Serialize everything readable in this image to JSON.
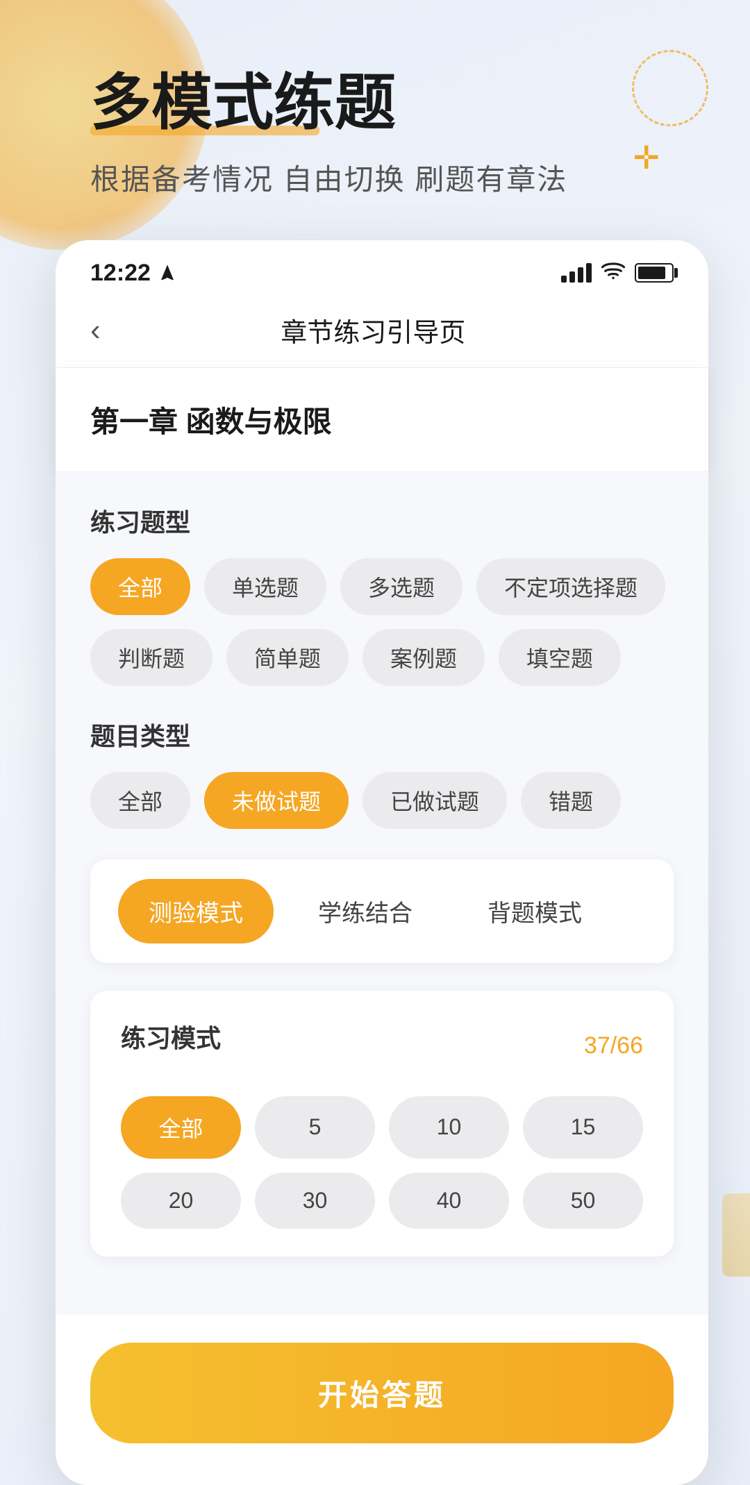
{
  "background": {
    "primary_color": "#e8eef8"
  },
  "header": {
    "title": "多模式练题",
    "subtitle": "根据备考情况 自由切换 刷题有章法"
  },
  "status_bar": {
    "time": "12:22",
    "time_icon": "navigation",
    "signal_label": "signal",
    "wifi_label": "wifi",
    "battery_label": "battery"
  },
  "nav": {
    "back_label": "‹",
    "title": "章节练习引导页"
  },
  "chapter": {
    "title": "第一章 函数与极限"
  },
  "question_type": {
    "label": "练习题型",
    "options": [
      {
        "id": "all",
        "label": "全部",
        "active": true
      },
      {
        "id": "single",
        "label": "单选题",
        "active": false
      },
      {
        "id": "multi",
        "label": "多选题",
        "active": false
      },
      {
        "id": "uncertain",
        "label": "不定项选择题",
        "active": false
      },
      {
        "id": "judge",
        "label": "判断题",
        "active": false
      },
      {
        "id": "simple",
        "label": "简单题",
        "active": false
      },
      {
        "id": "case",
        "label": "案例题",
        "active": false
      },
      {
        "id": "fill",
        "label": "填空题",
        "active": false
      }
    ]
  },
  "question_category": {
    "label": "题目类型",
    "options": [
      {
        "id": "all",
        "label": "全部",
        "active": false
      },
      {
        "id": "undone",
        "label": "未做试题",
        "active": true
      },
      {
        "id": "done",
        "label": "已做试题",
        "active": false
      },
      {
        "id": "wrong",
        "label": "错题",
        "active": false
      }
    ]
  },
  "mode_selector": {
    "options": [
      {
        "id": "test",
        "label": "测验模式",
        "active": true
      },
      {
        "id": "study",
        "label": "学练结合",
        "active": false
      },
      {
        "id": "back",
        "label": "背题模式",
        "active": false
      }
    ]
  },
  "practice_mode": {
    "label": "练习模式",
    "count": "37/66",
    "numbers": [
      {
        "id": "all",
        "label": "全部",
        "active": true
      },
      {
        "id": "5",
        "label": "5",
        "active": false
      },
      {
        "id": "10",
        "label": "10",
        "active": false
      },
      {
        "id": "15",
        "label": "15",
        "active": false
      },
      {
        "id": "20",
        "label": "20",
        "active": false
      },
      {
        "id": "30",
        "label": "30",
        "active": false
      },
      {
        "id": "40",
        "label": "40",
        "active": false
      },
      {
        "id": "50",
        "label": "50",
        "active": false
      }
    ]
  },
  "start_button": {
    "label": "开始答题"
  }
}
